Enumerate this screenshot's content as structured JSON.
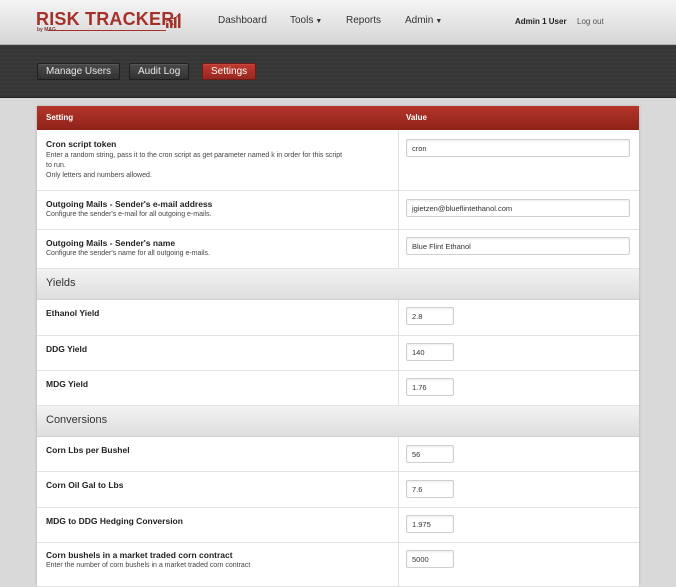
{
  "brand": {
    "name": "RISK TRACKER",
    "sub": "by MAG"
  },
  "nav": {
    "dashboard": "Dashboard",
    "tools": "Tools",
    "reports": "Reports",
    "admin": "Admin"
  },
  "user": {
    "name": "Admin 1 User",
    "logout": "Log out"
  },
  "subnav": {
    "manage_users": "Manage Users",
    "audit_log": "Audit Log",
    "settings": "Settings"
  },
  "table": {
    "col_setting": "Setting",
    "col_value": "Value"
  },
  "rows": {
    "cron": {
      "title": "Cron script token",
      "desc1": "Enter a random string, pass it to the cron script as get parameter named k in order for this script",
      "desc2": "to run.",
      "desc3": "Only letters and numbers allowed.",
      "value": "cron"
    },
    "sender_email": {
      "title": "Outgoing Mails - Sender's e-mail address",
      "desc": "Configure the sender's e-mail for all outgoing e-mails.",
      "value": "jgietzen@blueflintethanol.com"
    },
    "sender_name": {
      "title": "Outgoing Mails - Sender's name",
      "desc": "Configure the sender's name for all outgoing e-mails.",
      "value": "Blue Flint Ethanol"
    }
  },
  "sections": {
    "yields": "Yields",
    "conversions": "Conversions"
  },
  "yields": {
    "ethanol": {
      "title": "Ethanol Yield",
      "value": "2.8"
    },
    "ddg": {
      "title": "DDG Yield",
      "value": "140"
    },
    "mdg": {
      "title": "MDG Yield",
      "value": "1.76"
    }
  },
  "conversions": {
    "corn_lbs": {
      "title": "Corn Lbs per Bushel",
      "value": "56"
    },
    "corn_oil": {
      "title": "Corn Oil Gal to Lbs",
      "value": "7.6"
    },
    "mdg_ddg": {
      "title": "MDG to DDG Hedging Conversion",
      "value": "1.975"
    },
    "corn_contract": {
      "title": "Corn bushels in a market traded corn contract",
      "desc": "Enter the number of corn bushels in a market traded corn contract",
      "value": "5000"
    }
  },
  "colors": {
    "accent": "#a4322a",
    "header_dark": "#8e2219"
  },
  "icons": {
    "caret": "caret-down-icon",
    "logo_chart": "bar-chart-icon"
  }
}
